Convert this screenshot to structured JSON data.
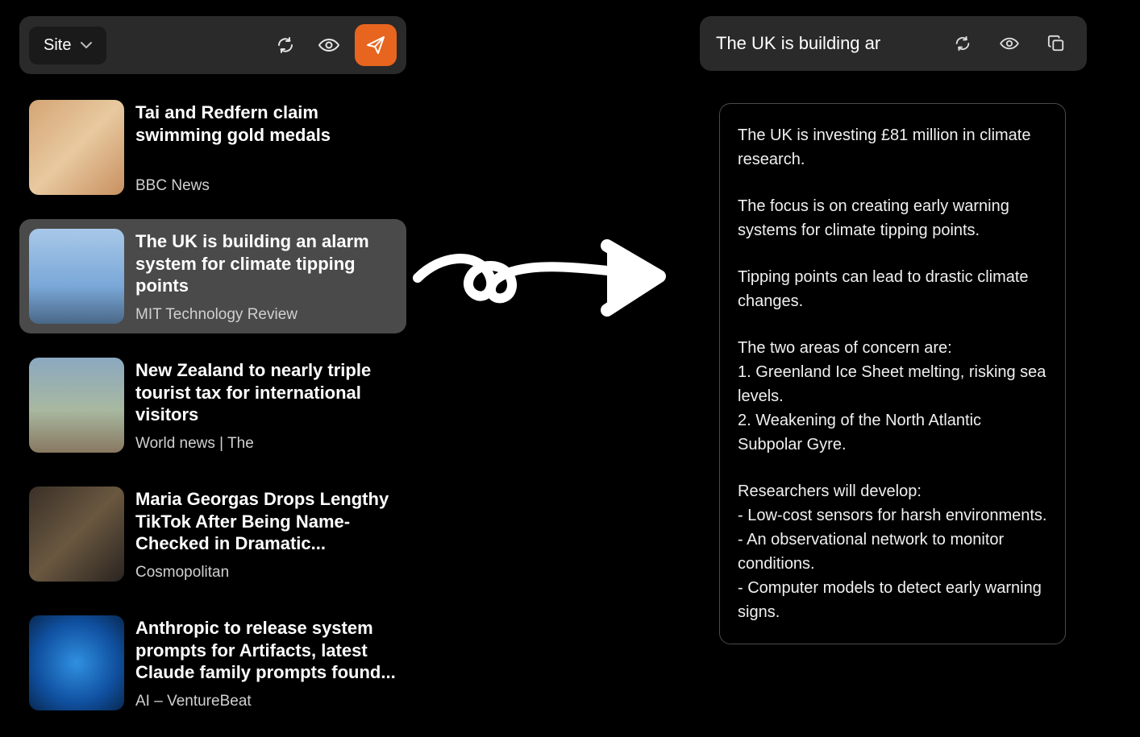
{
  "toolbar": {
    "site_label": "Site"
  },
  "articles": [
    {
      "title": "Tai and Redfern claim swimming gold medals",
      "source": "BBC News",
      "thumb": "sport",
      "selected": false
    },
    {
      "title": "The UK is building an alarm system for climate tipping points",
      "source": "MIT Technology Review",
      "thumb": "ice",
      "selected": true
    },
    {
      "title": "New Zealand to nearly triple tourist tax for international visitors",
      "source": "World news | The",
      "thumb": "nz",
      "selected": false
    },
    {
      "title": "Maria Georgas Drops Lengthy TikTok After Being Name-Checked in Dramatic...",
      "source": "Cosmopolitan",
      "thumb": "tiktok",
      "selected": false
    },
    {
      "title": "Anthropic to release system prompts for Artifacts, latest Claude family prompts found...",
      "source": "AI – VentureBeat",
      "thumb": "ai",
      "selected": false
    }
  ],
  "right": {
    "title": "The UK is building ar"
  },
  "summary": {
    "p1": "The UK is investing £81 million in climate research.",
    "p2": "The focus is on creating early warning systems for climate tipping points.",
    "p3": "Tipping points can lead to drastic climate changes.",
    "p4": "The two areas of concern are:\n1. Greenland Ice Sheet melting, risking sea levels.\n2. Weakening of the North Atlantic Subpolar Gyre.",
    "p5": "Researchers will develop:\n- Low-cost sensors for harsh environments.\n- An observational network to monitor conditions.\n- Computer models to detect early warning signs."
  }
}
